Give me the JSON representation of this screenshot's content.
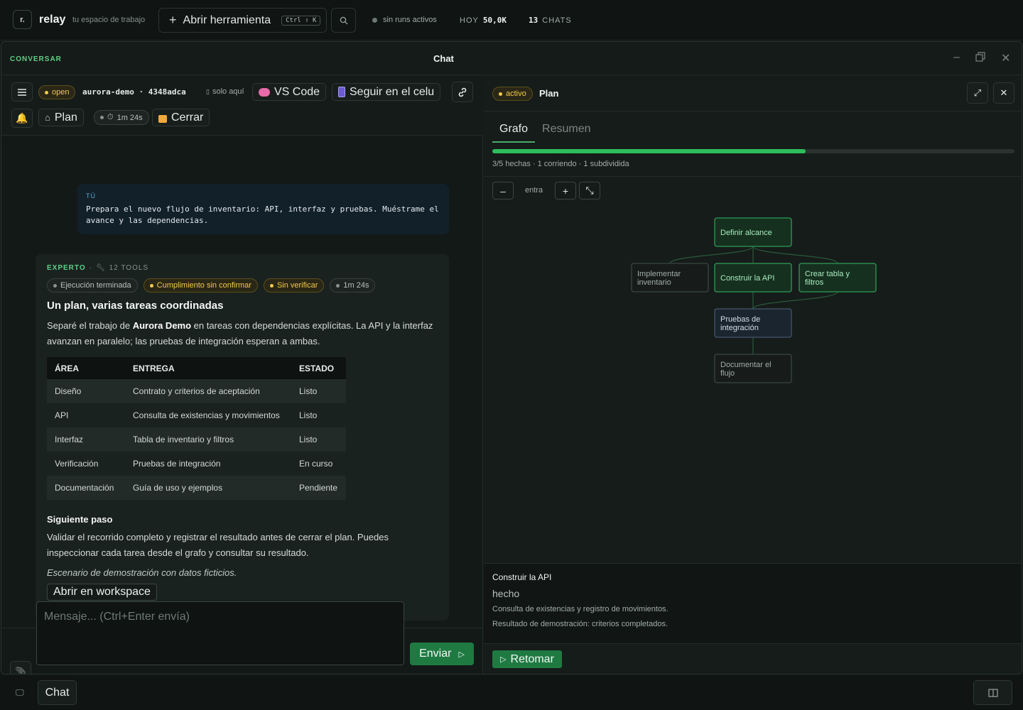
{
  "topbar": {
    "logo": "r.",
    "brand": "relay",
    "tagline": "tu espacio de trabajo",
    "open_tool_label": "Abrir herramienta",
    "open_tool_shortcut": "Ctrl ⇧ K",
    "runs_status": "sin runs activos",
    "hoy_label": "HOY",
    "hoy_value": "50,0K",
    "chats_count": "13",
    "chats_label": "CHATS"
  },
  "window": {
    "section": "CONVERSAR",
    "title": "Chat"
  },
  "chat_toolbar": {
    "status": "open",
    "session": "aurora-demo · 4348adca",
    "scope": "solo aquí",
    "vscode_label": "VS Code",
    "mobile_label": "Seguir en el celu",
    "plan_label": "Plan",
    "timer": "1m 24s",
    "close_label": "Cerrar"
  },
  "user_message": {
    "who": "TÚ",
    "text": "Prepara el nuevo flujo de inventario: API, interfaz y pruebas. Muéstrame el avance y las dependencias."
  },
  "assistant_message": {
    "role": "EXPERTO",
    "tools": "12 TOOLS",
    "pills": [
      "Ejecución terminada",
      "Cumplimiento sin confirmar",
      "Sin verificar",
      "1m 24s"
    ],
    "title": "Un plan, varias tareas coordinadas",
    "intro_before": "Separé el trabajo de ",
    "intro_bold": "Aurora Demo",
    "intro_after": " en tareas con dependencias explícitas. La API y la interfaz avanzan en paralelo; las pruebas de integración esperan a ambas.",
    "table": {
      "headers": [
        "ÁREA",
        "ENTREGA",
        "ESTADO"
      ],
      "rows": [
        [
          "Diseño",
          "Contrato y criterios de aceptación",
          "Listo"
        ],
        [
          "API",
          "Consulta de existencias y movimientos",
          "Listo"
        ],
        [
          "Interfaz",
          "Tabla de inventario y filtros",
          "Listo"
        ],
        [
          "Verificación",
          "Pruebas de integración",
          "En curso"
        ],
        [
          "Documentación",
          "Guía de uso y ejemplos",
          "Pendiente"
        ]
      ]
    },
    "next_title": "Siguiente paso",
    "next_text": "Validar el recorrido completo y registrar el resultado antes de cerrar el plan. Puedes inspeccionar cada tarea desde el grafo y consultar su resultado.",
    "note": "Escenario de demostración con datos ficticios.",
    "workspace_button": "Abrir en workspace"
  },
  "composer": {
    "placeholder": "Mensaje... (Ctrl+Enter envía)",
    "send_label": "Enviar"
  },
  "plan": {
    "status": "activo",
    "title": "Plan",
    "tabs": [
      "Grafo",
      "Resumen"
    ],
    "progress_fraction": 0.6,
    "progress_label": "3/5 hechas · 1 corriendo · 1 subdividida",
    "zoom_label": "entra",
    "nodes": [
      {
        "label_lines": [
          "Definir alcance"
        ],
        "state": "done"
      },
      {
        "label_lines": [
          "Implementar",
          "inventario"
        ],
        "state": "subdivided"
      },
      {
        "label_lines": [
          "Construir la API"
        ],
        "state": "done"
      },
      {
        "label_lines": [
          "Crear tabla y",
          "filtros"
        ],
        "state": "done"
      },
      {
        "label_lines": [
          "Pruebas de",
          "integración"
        ],
        "state": "running"
      },
      {
        "label_lines": [
          "Documentar el",
          "flujo"
        ],
        "state": "pending"
      }
    ],
    "detail": {
      "title": "Construir la API",
      "status": "hecho",
      "line1": "Consulta de existencias y registro de movimientos.",
      "line2": "Resultado de demostración: criterios completados."
    },
    "resume_label": "Retomar"
  },
  "bottombar": {
    "chat_label": "Chat"
  },
  "colors": {
    "accent_green": "#2ebd5b",
    "warning_yellow": "#f2c94c",
    "user_blue": "#5fa8d3"
  }
}
